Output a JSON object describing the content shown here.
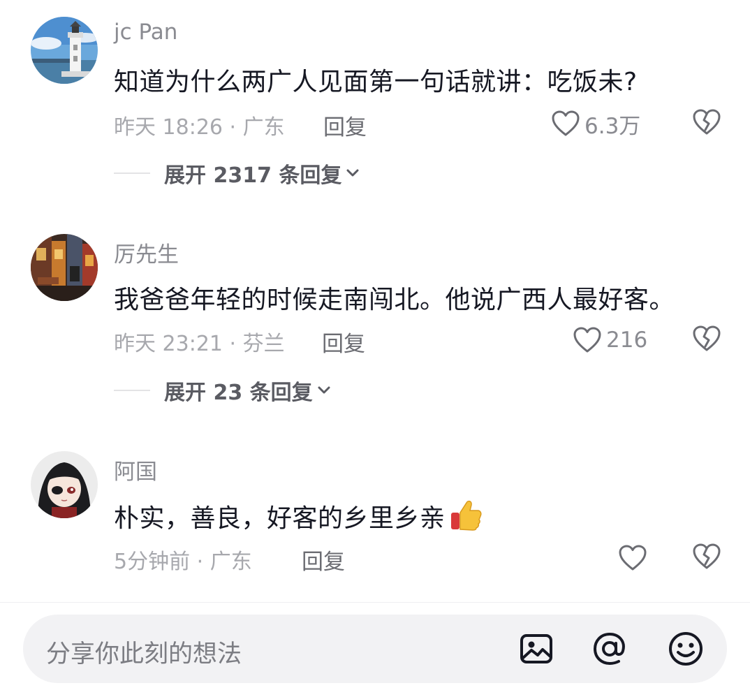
{
  "comments": [
    {
      "username": "jc Pan",
      "avatar_icon": "lighthouse-avatar-icon",
      "text": "知道为什么两广人见面第一句话就讲：吃饭未?",
      "meta": "昨天 18:26 · 广东",
      "reply_label": "回复",
      "like_count": "6.3万",
      "expand_label": "展开 2317 条回复"
    },
    {
      "username": "厉先生",
      "avatar_icon": "street-scene-avatar-icon",
      "text": "我爸爸年轻的时候走南闯北。他说广西人最好客。",
      "meta": "昨天 23:21 · 芬兰",
      "reply_label": "回复",
      "like_count": "216",
      "expand_label": "展开 23 条回复"
    },
    {
      "username": "阿国",
      "avatar_icon": "anime-character-avatar-icon",
      "text": "朴实，善良，好客的乡里乡亲",
      "emoji": "thumbs-up-emoji",
      "meta": "5分钟前 · 广东",
      "reply_label": "回复",
      "like_count": ""
    }
  ],
  "input_bar": {
    "placeholder": "分享你此刻的想法",
    "icons": [
      "image-icon",
      "at-mention-icon",
      "emoji-face-icon"
    ]
  },
  "colors": {
    "text_primary": "#161823",
    "text_secondary": "#8a8b91",
    "input_bg": "#f2f2f4"
  }
}
